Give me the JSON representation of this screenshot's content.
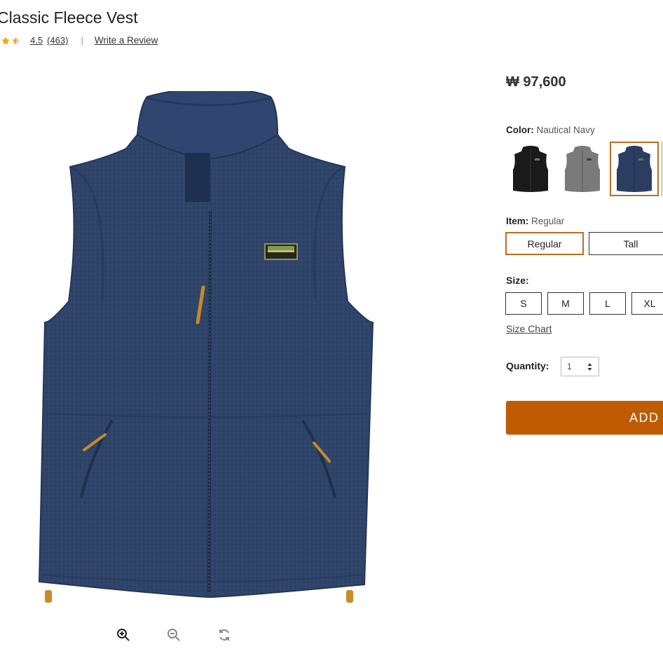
{
  "product": {
    "title": "Classic Fleece Vest",
    "rating_value": "4.5",
    "review_count": "(463)",
    "separator": "|",
    "write_review": "Write a Review",
    "price": "₩ 97,600"
  },
  "color": {
    "label": "Color:",
    "selected": "Nautical Navy",
    "swatches": [
      {
        "name": "Black",
        "color": "#1a1a1a"
      },
      {
        "name": "Gray",
        "color": "#7a7a7a"
      },
      {
        "name": "Nautical Navy",
        "color": "#2c3d62",
        "selected": true
      }
    ]
  },
  "item": {
    "label": "Item:",
    "selected": "Regular",
    "options": [
      "Regular",
      "Tall"
    ]
  },
  "size": {
    "label": "Size:",
    "options": [
      "S",
      "M",
      "L",
      "XL"
    ],
    "chart_link": "Size Chart"
  },
  "quantity": {
    "label": "Quantity:",
    "value": "1"
  },
  "cart": {
    "add_label": "ADD"
  },
  "image_controls": [
    "zoom-in-icon",
    "zoom-out-icon",
    "rotate-icon"
  ],
  "colors": {
    "accent": "#b8701d",
    "cta": "#bf5b00",
    "star": "#f0a500"
  }
}
